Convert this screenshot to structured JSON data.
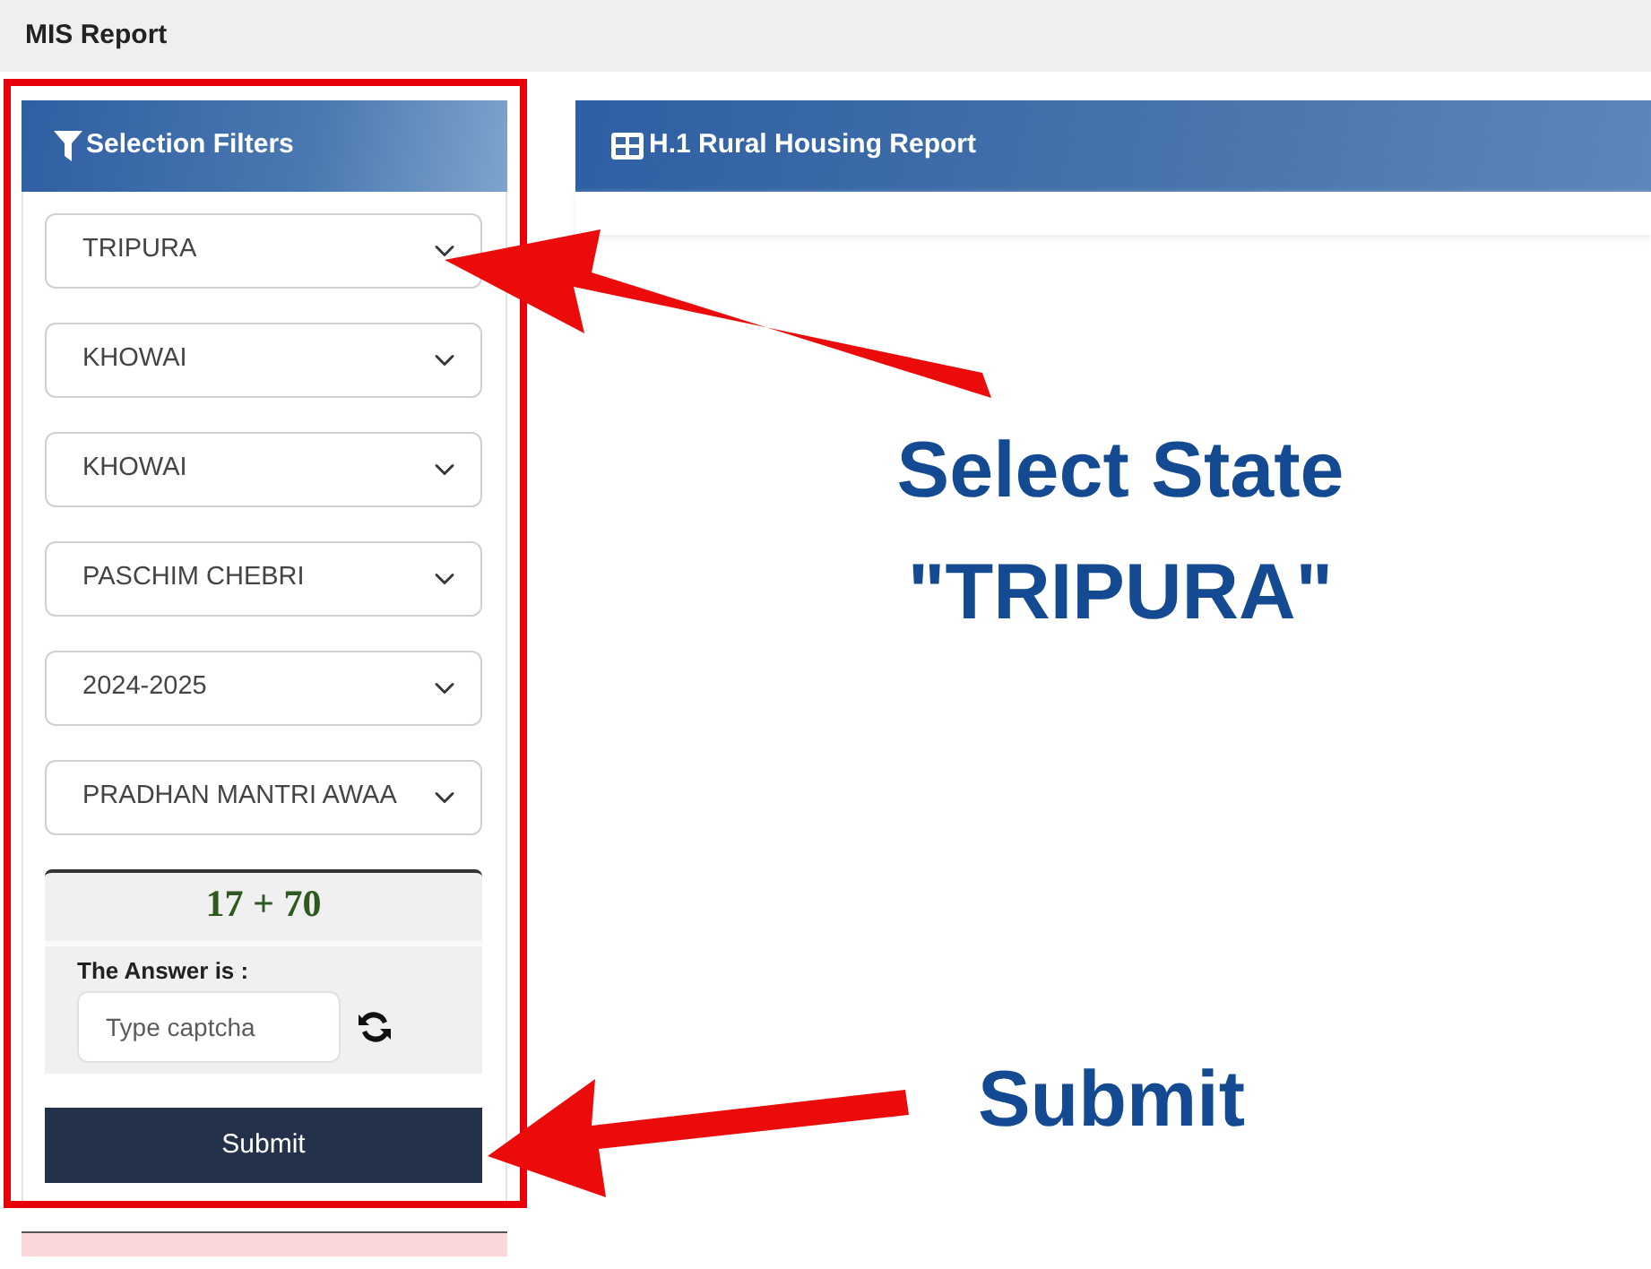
{
  "header": {
    "title": "MIS Report"
  },
  "filters": {
    "title": "Selection Filters",
    "selects": [
      {
        "value": "TRIPURA"
      },
      {
        "value": "KHOWAI"
      },
      {
        "value": "KHOWAI"
      },
      {
        "value": "PASCHIM CHEBRI"
      },
      {
        "value": "2024-2025"
      },
      {
        "value": "PRADHAN MANTRI AWAA"
      }
    ],
    "captcha": {
      "question": "17 + 70",
      "label": "The Answer is :",
      "placeholder": "Type captcha"
    },
    "submit": "Submit"
  },
  "report": {
    "title": "H.1 Rural Housing Report"
  },
  "annotations": [
    {
      "kind": "callout",
      "lines": [
        "Select State",
        "\"TRIPURA\""
      ]
    },
    {
      "kind": "callout",
      "lines": [
        "Submit"
      ]
    }
  ]
}
